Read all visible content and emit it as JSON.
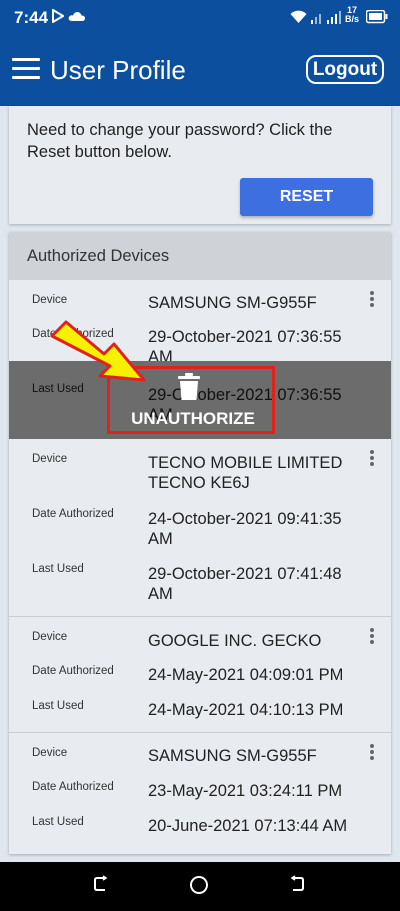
{
  "status_bar": {
    "time": "7:44",
    "net_speed_value": "17",
    "net_speed_unit": "B/s"
  },
  "app_bar": {
    "title": "User Profile",
    "logout_label": "Logout"
  },
  "reset_card": {
    "message": "Need to change your password? Click the Reset button below.",
    "reset_label": "RESET"
  },
  "devices": {
    "title": "Authorized Devices",
    "labels": {
      "device": "Device",
      "date_authorized": "Date Authorized",
      "last_used": "Last Used"
    },
    "items": [
      {
        "device": "SAMSUNG SM-G955F",
        "date_authorized": "29-October-2021 07:36:55 AM",
        "last_used": "29-October-2021 07:36:55 AM"
      },
      {
        "device": "TECNO MOBILE LIMITED TECNO KE6J",
        "date_authorized": "24-October-2021 09:41:35 AM",
        "last_used": "29-October-2021 07:41:48 AM"
      },
      {
        "device": "GOOGLE INC. GECKO",
        "date_authorized": "24-May-2021 04:09:01 PM",
        "last_used": "24-May-2021 04:10:13 PM"
      },
      {
        "device": "SAMSUNG SM-G955F",
        "date_authorized": "23-May-2021 03:24:11 PM",
        "last_used": "20-June-2021 07:13:44 AM"
      }
    ],
    "unauthorize_label": "UNAUTHORIZE"
  },
  "colors": {
    "app_bar": "#0b4f9e",
    "reset_button": "#3d6fe0",
    "highlight_box": "#e0221d",
    "arrow_fill": "#f6f100",
    "overlay": "#6c6c6c"
  },
  "icons": [
    "hamburger-menu-icon",
    "trash-icon",
    "more-vert-icon",
    "wifi-icon",
    "signal-icon",
    "battery-icon",
    "cloud-icon",
    "play-icon"
  ]
}
